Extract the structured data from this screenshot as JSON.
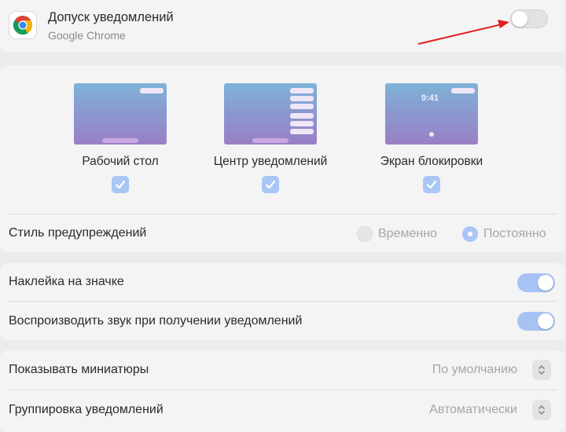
{
  "header": {
    "app_icon": "google-chrome-logo",
    "title": "Допуск уведомлений",
    "subtitle": "Google Chrome",
    "allow_notifications": false
  },
  "previews": [
    {
      "key": "desktop",
      "label": "Рабочий стол",
      "checked": true
    },
    {
      "key": "center",
      "label": "Центр уведомлений",
      "checked": true
    },
    {
      "key": "lock",
      "label": "Экран блокировки",
      "checked": true,
      "clock": "9:41"
    }
  ],
  "alert_style": {
    "label": "Стиль предупреждений",
    "options": [
      {
        "label": "Временно",
        "selected": false
      },
      {
        "label": "Постоянно",
        "selected": true
      }
    ]
  },
  "badge": {
    "label": "Наклейка на значке",
    "on": true
  },
  "sound": {
    "label": "Воспроизводить звук при получении уведомлений",
    "on": true
  },
  "previews_setting": {
    "label": "Показывать миниатюры",
    "value": "По умолчанию"
  },
  "grouping": {
    "label": "Группировка уведомлений",
    "value": "Автоматически"
  },
  "colors": {
    "accent": "#a9c6f5",
    "toggle_on": "#a7c3f4",
    "annotation_arrow": "#e02020"
  }
}
